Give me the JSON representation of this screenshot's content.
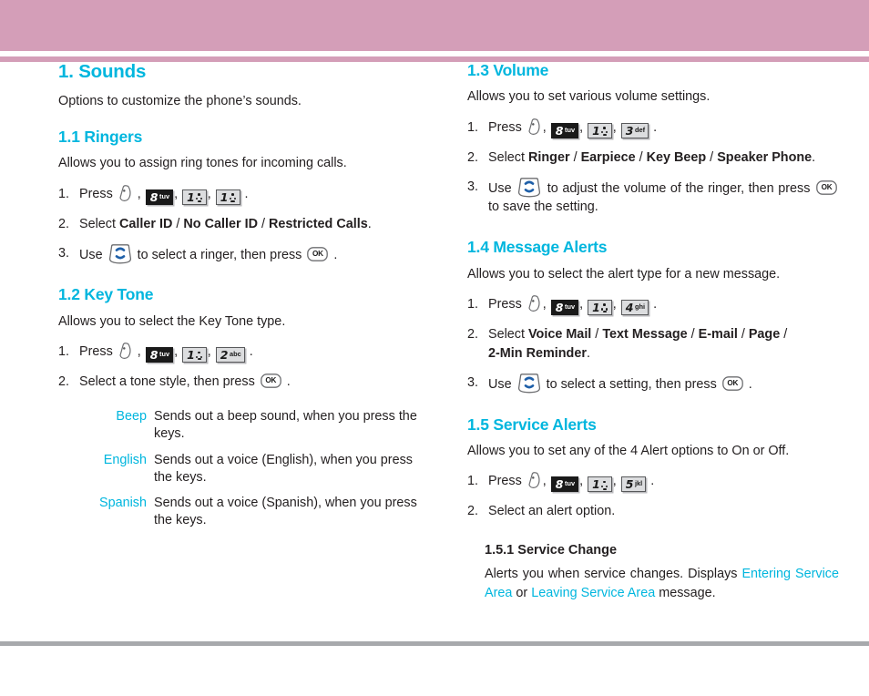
{
  "theme": {
    "header_band_color": "#d49eb8",
    "footer_rule_color": "#a7a9ac",
    "heading_color": "#00b6de",
    "body_color": "#231f20",
    "key_dark_bg": "#1a1a1a",
    "key_light_bg": "#dcdddf"
  },
  "left_column": {
    "section": {
      "title": "1. Sounds",
      "intro": "Options to customize the phone’s sounds."
    },
    "ringers": {
      "title": "1.1 Ringers",
      "intro": "Allows you to assign ring tones for incoming calls.",
      "steps": [
        {
          "marker": "1.",
          "lead": "Press",
          "keys": [
            "menu",
            "8 tuv",
            "1",
            "1"
          ],
          "tail": "."
        },
        {
          "marker": "2.",
          "lead": "Select",
          "options": [
            "Caller ID",
            "No Caller ID",
            "Restricted Calls"
          ],
          "tail": "."
        },
        {
          "marker": "3.",
          "lead": "Use",
          "nav": "navigation-key",
          "mid": "to select a ringer, then press",
          "ok": "OK",
          "tail": "."
        }
      ]
    },
    "key_tone": {
      "title": "1.2 Key Tone",
      "intro": "Allows you to select the Key Tone type.",
      "steps": [
        {
          "marker": "1.",
          "lead": "Press",
          "keys": [
            "menu",
            "8 tuv",
            "1",
            "2 abc"
          ],
          "tail": "."
        },
        {
          "marker": "2.",
          "lead": "Select a tone style, then press",
          "ok": "OK",
          "tail": "."
        }
      ],
      "definitions": [
        {
          "term": "Beep",
          "desc": "Sends out a beep sound, when you press the keys."
        },
        {
          "term": "English",
          "desc": "Sends out a voice (English), when you press the keys."
        },
        {
          "term": "Spanish",
          "desc": "Sends out a voice (Spanish), when you press the keys."
        }
      ]
    }
  },
  "right_column": {
    "volume": {
      "title": "1.3 Volume",
      "intro": "Allows you to set various volume settings.",
      "steps": [
        {
          "marker": "1.",
          "lead": "Press",
          "keys": [
            "menu",
            "8 tuv",
            "1",
            "3 def"
          ],
          "tail": "."
        },
        {
          "marker": "2.",
          "lead": "Select",
          "options": [
            "Ringer",
            "Earpiece",
            "Key Beep",
            "Speaker Phone"
          ],
          "tail": "."
        },
        {
          "marker": "3.",
          "lead": "Use",
          "nav": "navigation-key",
          "mid": "to adjust the volume of the ringer, then press",
          "ok": "OK",
          "tail2": "to save the setting."
        }
      ]
    },
    "message_alerts": {
      "title": "1.4 Message Alerts",
      "intro": "Allows you to select the alert type for a new message.",
      "steps": [
        {
          "marker": "1.",
          "lead": "Press",
          "keys": [
            "menu",
            "8 tuv",
            "1",
            "4 ghi"
          ],
          "tail": "."
        },
        {
          "marker": "2.",
          "lead": "Select",
          "options": [
            "Voice Mail",
            "Text Message",
            "E-mail",
            "Page",
            "2-Min Reminder"
          ],
          "tail": "."
        },
        {
          "marker": "3.",
          "lead": "Use",
          "nav": "navigation-key",
          "mid": "to select a setting, then press",
          "ok": "OK",
          "tail": "."
        }
      ]
    },
    "service_alerts": {
      "title": "1.5 Service Alerts",
      "intro": "Allows you to set any of the 4 Alert options to On or Off.",
      "steps": [
        {
          "marker": "1.",
          "lead": "Press",
          "keys": [
            "menu",
            "8 tuv",
            "1",
            "5 jkl"
          ],
          "tail": "."
        },
        {
          "marker": "2.",
          "lead": "Select an alert option."
        }
      ],
      "service_change": {
        "title_num": "1.5.1",
        "title_text": "Service Change",
        "body_pre": "Alerts you when service changes. Displays ",
        "highlight_1": "Entering Service Area",
        "body_mid": " or ",
        "highlight_2": "Leaving Service Area",
        "body_post": " message."
      }
    }
  },
  "keys": {
    "k8": {
      "digit": "8",
      "letters": "tuv",
      "style": "dark"
    },
    "k1": {
      "digit": "1",
      "letters": "",
      "style": "light"
    },
    "k2": {
      "digit": "2",
      "letters": "abc",
      "style": "light"
    },
    "k3": {
      "digit": "3",
      "letters": "def",
      "style": "light"
    },
    "k4": {
      "digit": "4",
      "letters": "ghi",
      "style": "light"
    },
    "k5": {
      "digit": "5",
      "letters": "jkl",
      "style": "light"
    },
    "ok_label": "OK"
  }
}
